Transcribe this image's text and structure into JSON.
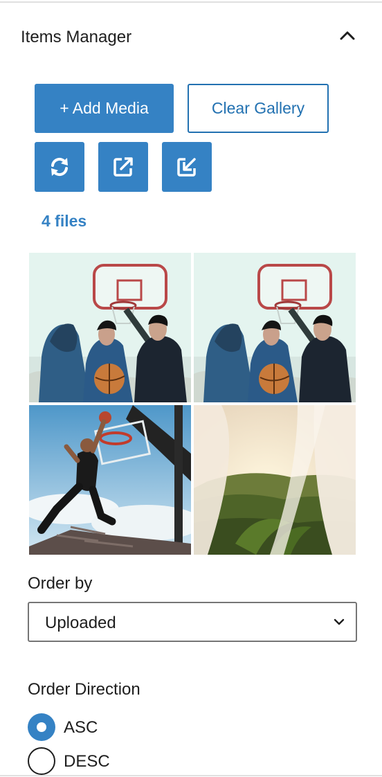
{
  "panel": {
    "title": "Items Manager",
    "toggle_icon": "chevron-up-icon"
  },
  "toolbar": {
    "add_media_label": "+ Add Media",
    "clear_gallery_label": "Clear Gallery",
    "icons": [
      "refresh-icon",
      "external-link-icon",
      "import-icon"
    ],
    "accent_color": "#3582c4"
  },
  "gallery": {
    "file_count": "4 files",
    "items": [
      {
        "description": "three-young-men-under-basketball-hoop"
      },
      {
        "description": "three-young-men-under-basketball-hoop"
      },
      {
        "description": "player-dunking-basketball"
      },
      {
        "description": "sunlit-curtains-over-green-valley"
      }
    ]
  },
  "order_by": {
    "label": "Order by",
    "selected": "Uploaded"
  },
  "order_direction": {
    "label": "Order Direction",
    "options": [
      {
        "label": "ASC",
        "checked": true
      },
      {
        "label": "DESC",
        "checked": false
      }
    ]
  }
}
